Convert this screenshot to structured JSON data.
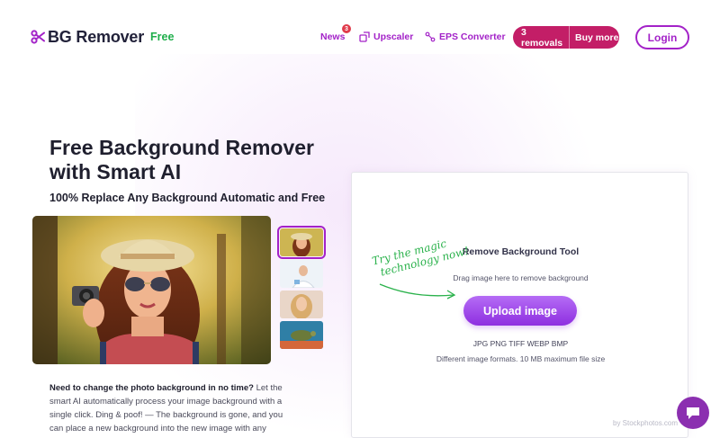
{
  "header": {
    "logo_text": "BG Remover",
    "logo_badge": "Free",
    "nav": {
      "news_label": "News",
      "news_badge": "3",
      "upscaler_label": "Upscaler",
      "eps_label": "EPS Converter"
    },
    "removals_label": "3 removals",
    "buy_more_label": "Buy more",
    "login_label": "Login"
  },
  "hero": {
    "title": "Free Background Remover with Smart AI",
    "subtitle": "100% Replace Any Background Automatic and Free",
    "description_bold": "Need to change the photo background in no time?",
    "description_rest": " Let the smart AI automatically process your image background with a single click. Ding & poof! — The background is gone, and you can place a new background into the new image with any design tools."
  },
  "tool": {
    "handwritten_line1": "Try the magic",
    "handwritten_line2": "technology now!",
    "title": "Remove Background Tool",
    "drag_text": "Drag image here to remove background",
    "upload_label": "Upload image",
    "formats": "JPG PNG TIFF WEBP BMP",
    "formats_note": "Different image formats. 10 MB maximum file size",
    "credit": "by Stockphotos.com"
  },
  "colors": {
    "accent": "#a322c8",
    "brand_green": "#1fae4b",
    "removals_bg": "#c31e67",
    "upload_gradient_start": "#b56cf5",
    "upload_gradient_end": "#8e2fe0",
    "chat_bg": "#8b2fb0"
  },
  "icons": {
    "logo": "scissors-icon",
    "upscaler": "upscale-icon",
    "eps": "eps-converter-icon",
    "chat": "chat-bubble-icon",
    "arrow": "hand-drawn-arrow-icon"
  }
}
